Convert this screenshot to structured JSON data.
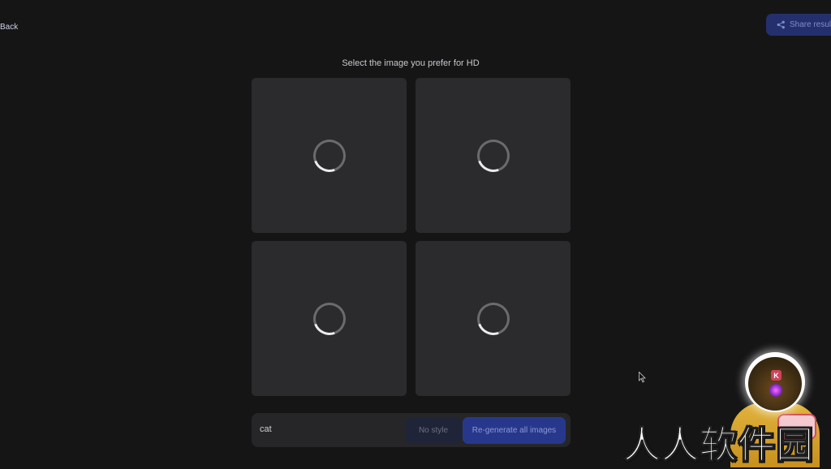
{
  "nav": {
    "back_label": "Back"
  },
  "share": {
    "label": "Share result",
    "icon": "share-icon"
  },
  "prompt_title": "Select the image you prefer for HD",
  "tiles": [
    {
      "status": "loading"
    },
    {
      "status": "loading"
    },
    {
      "status": "loading"
    },
    {
      "status": "loading"
    }
  ],
  "prompt_bar": {
    "input_value": "cat",
    "no_style_label": "No style",
    "regenerate_label": "Re-generate all images"
  },
  "overlay": {
    "avatar_badge": "K",
    "watermark": "人人软件园"
  },
  "colors": {
    "background": "#151516",
    "tile": "#2b2b2d",
    "accent": "#27388c"
  }
}
